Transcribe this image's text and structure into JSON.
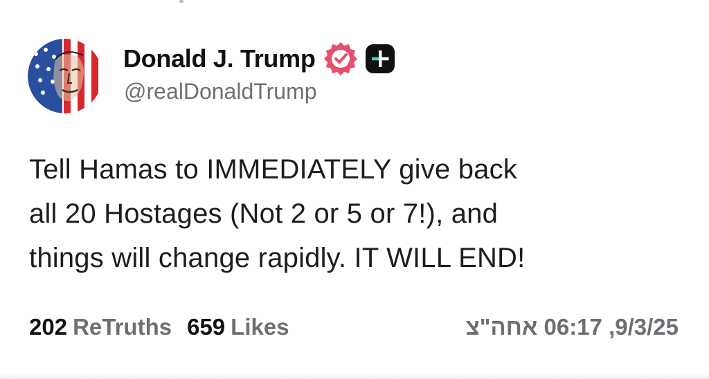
{
  "post": {
    "author": {
      "display_name": "Donald J. Trump",
      "handle": "@realDonaldTrump",
      "avatar_icon": "flag-portrait-avatar",
      "badges": [
        "verified-badge-icon",
        "plus-icon"
      ],
      "verified_color": "#e64d6e"
    },
    "body_lines": [
      "Tell Hamas to IMMEDIATELY give back",
      "all 20 Hostages (Not 2 or 5 or 7!), and",
      "things will change rapidly. IT WILL END!"
    ],
    "stats": {
      "retruths_count": "202",
      "retruths_label": "ReTruths",
      "likes_count": "659",
      "likes_label": "Likes"
    },
    "timestamp": "9/3/25, 06:17 אחה\"צ"
  }
}
